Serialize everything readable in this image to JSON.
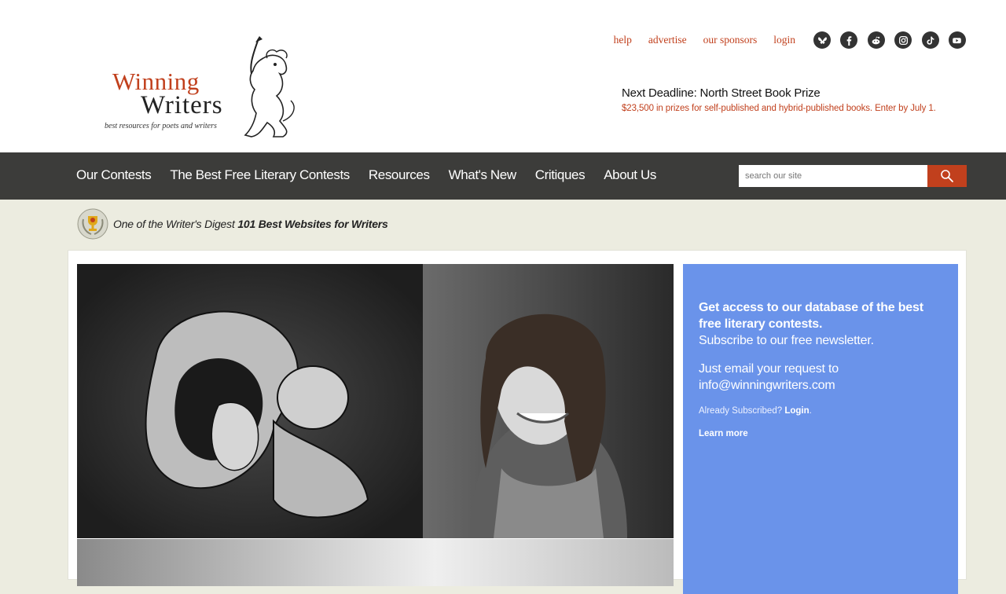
{
  "logo": {
    "line1": "Winning",
    "line2": "Writers",
    "tagline": "best resources for poets and writers"
  },
  "top_links": [
    "help",
    "advertise",
    "our sponsors",
    "login"
  ],
  "social_icons": [
    "bluesky-icon",
    "facebook-icon",
    "reddit-icon",
    "instagram-icon",
    "tiktok-icon",
    "youtube-icon"
  ],
  "deadline": {
    "title": "Next Deadline: North Street Book Prize",
    "subtitle": "$23,500 in prizes for self-published and hybrid-published books. Enter by July 1."
  },
  "nav": [
    "Our Contests",
    "The Best Free Literary Contests",
    "Resources",
    "What's New",
    "Critiques",
    "About Us"
  ],
  "search": {
    "placeholder": "search our site"
  },
  "award": {
    "prefix": "One of the Writer's Digest ",
    "bold": "101 Best Websites for Writers"
  },
  "promo": {
    "line1": "Get access to our database of the best free literary contests.",
    "line2": "Subscribe to our free newsletter.",
    "line3": "Just email your request to info@winningwriters.com",
    "already": "Already Subscribed? ",
    "login": "Login",
    "learn_more": "Learn more"
  },
  "colors": {
    "accent": "#c1401d",
    "navbar": "#3c3c3a",
    "promo": "#6a93ea",
    "page_bg": "#ecece0"
  }
}
